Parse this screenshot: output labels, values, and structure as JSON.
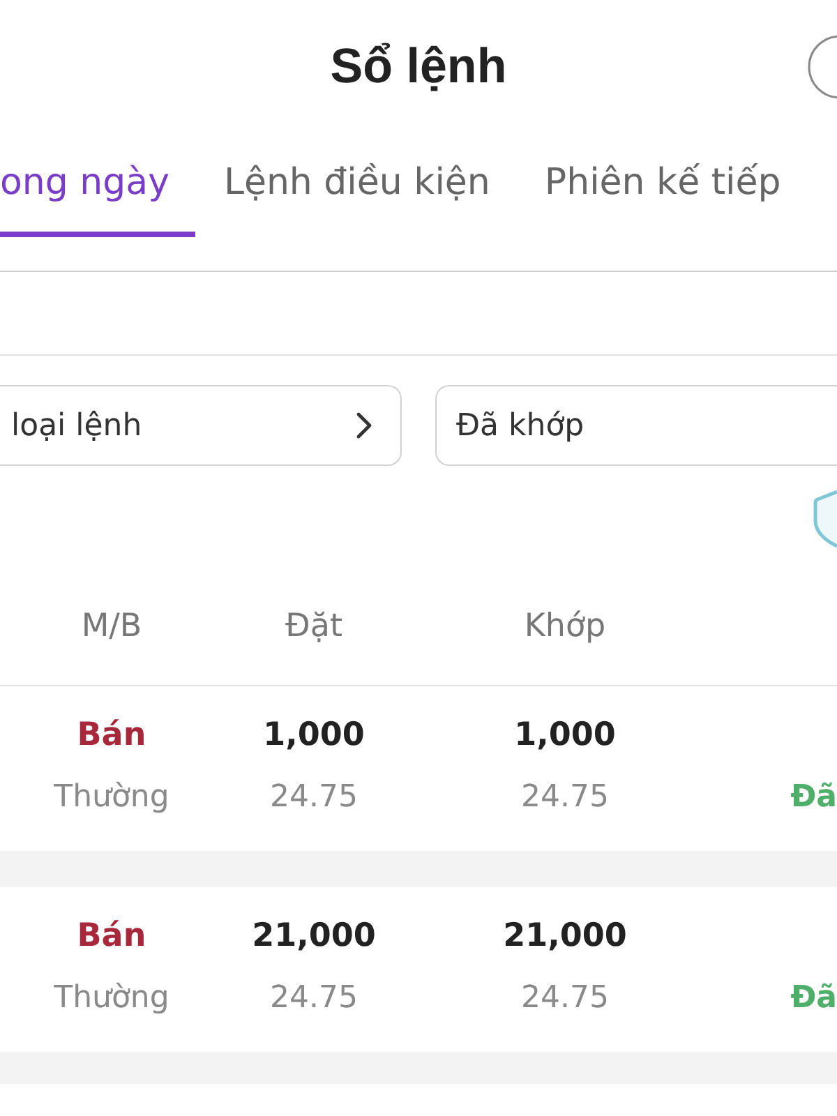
{
  "header": {
    "title": "Sổ lệnh"
  },
  "tabs": [
    {
      "label": "ong ngày",
      "selected": true
    },
    {
      "label": "Lệnh điều kiện",
      "selected": false
    },
    {
      "label": "Phiên kế tiếp",
      "selected": false
    }
  ],
  "filters": [
    {
      "kind": "navigate",
      "value": "loại lệnh"
    },
    {
      "kind": "select",
      "value": "Đã khớp"
    }
  ],
  "table": {
    "columns": [
      "M/B",
      "Đặt",
      "Khớp"
    ],
    "rows": [
      {
        "kind": "sell",
        "side": "Bán",
        "order_type": "Thường",
        "ordered_qty": "1,000",
        "ordered_price": "24.75",
        "matched_qty": "1,000",
        "matched_price": "24.75",
        "status": "Đã"
      },
      {
        "kind": "sell",
        "side": "Bán",
        "order_type": "Thường",
        "ordered_qty": "21,000",
        "ordered_price": "24.75",
        "matched_qty": "21,000",
        "matched_price": "24.75",
        "status": "Đã"
      }
    ]
  }
}
